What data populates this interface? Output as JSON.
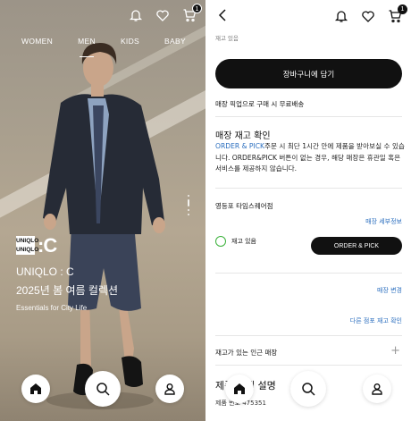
{
  "left_panel": {
    "category_tabs": [
      "WOMEN",
      "MEN",
      "KIDS",
      "BABY"
    ],
    "active_tab": "MEN",
    "cart_count": "1",
    "logo": {
      "letters": [
        "UNI",
        "QLO",
        "UNI",
        "QLO"
      ],
      "suffix": ":C"
    },
    "hero": {
      "title": "UNIQLO : C",
      "subtitle": "2025년 봄 여름 컬렉션",
      "description": "Essentials for City Life"
    },
    "nav": {
      "home": "home-icon",
      "search": "search-icon",
      "account": "user-icon"
    }
  },
  "right_panel": {
    "cart_count": "1",
    "stock_label_top": "재고 있음",
    "add_to_cart_label": "장바구니에 담기",
    "free_shipping": "매장 픽업으로 구매 시 무료배송",
    "stock_check": {
      "title": "매장 재고 확인",
      "highlight": "ORDER & PICK",
      "description": "주문 시 최단 1시간 안에 제품을 받아보실 수 있습니다. ORDER&PICK 버튼이 없는 경우, 해당 매장은 휴관일 혹은 서비스를 제공하지 않습니다."
    },
    "store": {
      "name": "영등포 타임스퀘어점",
      "details_link": "매장 세부정보",
      "status": "재고 있음",
      "order_pick_button": "ORDER & PICK"
    },
    "change_store_link": "매장 변경",
    "other_stores_link": "다른 점포 재고 확인",
    "nearby_stores": "재고가 있는 인근 매장",
    "product_description_title": "제품 상세 설명",
    "product_number": "제품 번호 475351"
  },
  "colors": {
    "accent_link": "#2c6fbf",
    "dark": "#111111",
    "in_stock": "#3bb23b"
  }
}
